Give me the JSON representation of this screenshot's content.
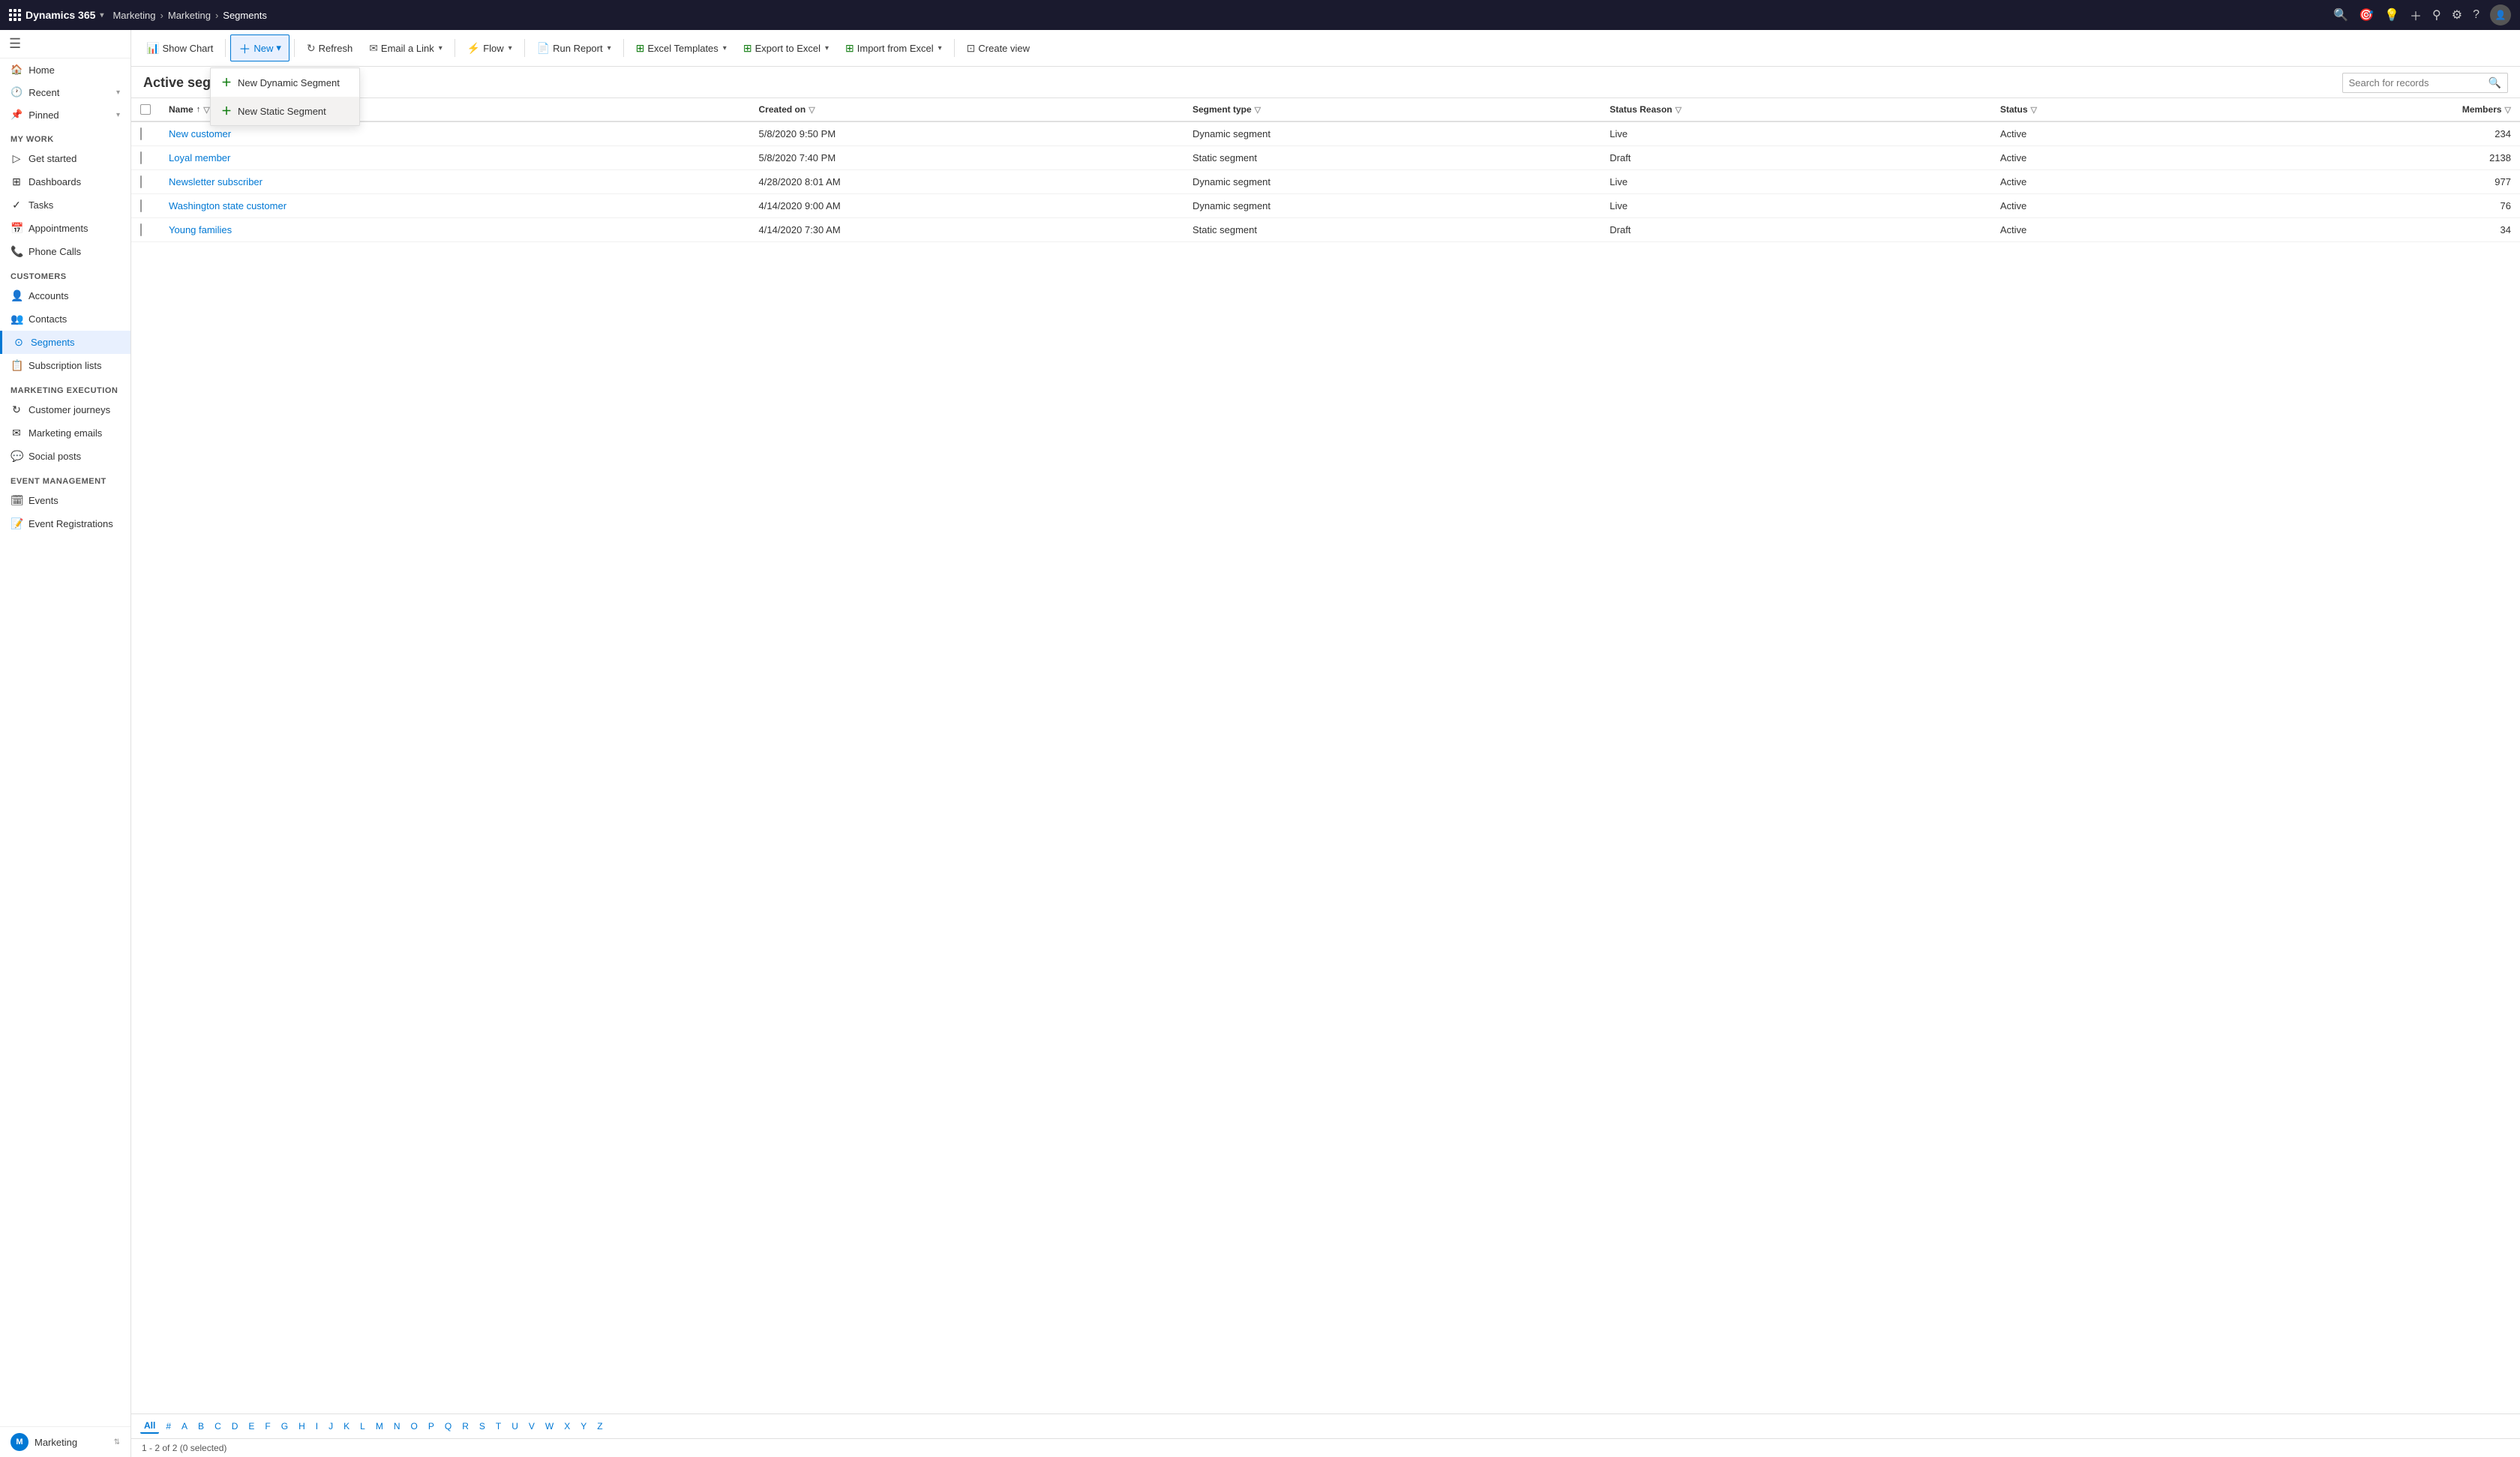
{
  "topnav": {
    "logo": "Dynamics 365",
    "breadcrumb": [
      "Marketing",
      "Marketing",
      "Segments"
    ],
    "chevron": "▾"
  },
  "sidebar": {
    "hamburger": "☰",
    "my_work_label": "My Work",
    "my_work_items": [
      {
        "id": "get-started",
        "icon": "▷",
        "label": "Get started"
      },
      {
        "id": "recent",
        "icon": "🕐",
        "label": "Recent",
        "arrow": "▾"
      },
      {
        "id": "pinned",
        "icon": "📌",
        "label": "Pinned",
        "arrow": "▾"
      },
      {
        "id": "dashboards",
        "icon": "⊞",
        "label": "Dashboards"
      },
      {
        "id": "tasks",
        "icon": "✓",
        "label": "Tasks"
      },
      {
        "id": "appointments",
        "icon": "📅",
        "label": "Appointments"
      },
      {
        "id": "phone-calls",
        "icon": "📞",
        "label": "Phone Calls"
      }
    ],
    "customers_label": "Customers",
    "customers_items": [
      {
        "id": "accounts",
        "icon": "👤",
        "label": "Accounts"
      },
      {
        "id": "contacts",
        "icon": "👥",
        "label": "Contacts"
      },
      {
        "id": "segments",
        "icon": "⊙",
        "label": "Segments",
        "active": true
      },
      {
        "id": "subscription-lists",
        "icon": "📋",
        "label": "Subscription lists"
      }
    ],
    "marketing_exec_label": "Marketing execution",
    "marketing_exec_items": [
      {
        "id": "customer-journeys",
        "icon": "↻",
        "label": "Customer journeys"
      },
      {
        "id": "marketing-emails",
        "icon": "✉",
        "label": "Marketing emails"
      },
      {
        "id": "social-posts",
        "icon": "💬",
        "label": "Social posts"
      }
    ],
    "event_mgmt_label": "Event management",
    "event_mgmt_items": [
      {
        "id": "events",
        "icon": "🗓",
        "label": "Events"
      },
      {
        "id": "event-registrations",
        "icon": "📝",
        "label": "Event Registrations"
      }
    ],
    "bottom_label": "Marketing",
    "bottom_avatar": "M"
  },
  "toolbar": {
    "show_chart": "Show Chart",
    "new": "New",
    "refresh": "Refresh",
    "email_link": "Email a Link",
    "flow": "Flow",
    "run_report": "Run Report",
    "excel_templates": "Excel Templates",
    "export_to_excel": "Export to Excel",
    "import_from_excel": "Import from Excel",
    "create_view": "Create view"
  },
  "dropdown": {
    "new_dynamic": "New Dynamic Segment",
    "new_static": "New Static Segment"
  },
  "page": {
    "title": "Active segments",
    "search_placeholder": "Search for records"
  },
  "table": {
    "columns": [
      {
        "id": "name",
        "label": "Name",
        "sortable": true,
        "filterable": true
      },
      {
        "id": "created_on",
        "label": "Created on",
        "filterable": true
      },
      {
        "id": "segment_type",
        "label": "Segment type",
        "filterable": true
      },
      {
        "id": "status_reason",
        "label": "Status Reason",
        "filterable": true
      },
      {
        "id": "status",
        "label": "Status",
        "filterable": true
      },
      {
        "id": "members",
        "label": "Members",
        "filterable": true
      }
    ],
    "rows": [
      {
        "name": "New customer",
        "created_on": "5/8/2020 9:50 PM",
        "segment_type": "Dynamic segment",
        "status_reason": "Live",
        "status": "Active",
        "members": "234"
      },
      {
        "name": "Loyal member",
        "created_on": "5/8/2020 7:40 PM",
        "segment_type": "Static segment",
        "status_reason": "Draft",
        "status": "Active",
        "members": "2138"
      },
      {
        "name": "Newsletter subscriber",
        "created_on": "4/28/2020 8:01 AM",
        "segment_type": "Dynamic segment",
        "status_reason": "Live",
        "status": "Active",
        "members": "977"
      },
      {
        "name": "Washington state customer",
        "created_on": "4/14/2020 9:00 AM",
        "segment_type": "Dynamic segment",
        "status_reason": "Live",
        "status": "Active",
        "members": "76"
      },
      {
        "name": "Young families",
        "created_on": "4/14/2020 7:30 AM",
        "segment_type": "Static segment",
        "status_reason": "Draft",
        "status": "Active",
        "members": "34"
      }
    ]
  },
  "alpha_bar": {
    "items": [
      "All",
      "#",
      "A",
      "B",
      "C",
      "D",
      "E",
      "F",
      "G",
      "H",
      "I",
      "J",
      "K",
      "L",
      "M",
      "N",
      "O",
      "P",
      "Q",
      "R",
      "S",
      "T",
      "U",
      "V",
      "W",
      "X",
      "Y",
      "Z"
    ]
  },
  "status_bar": {
    "text": "1 - 2 of 2 (0 selected)"
  }
}
